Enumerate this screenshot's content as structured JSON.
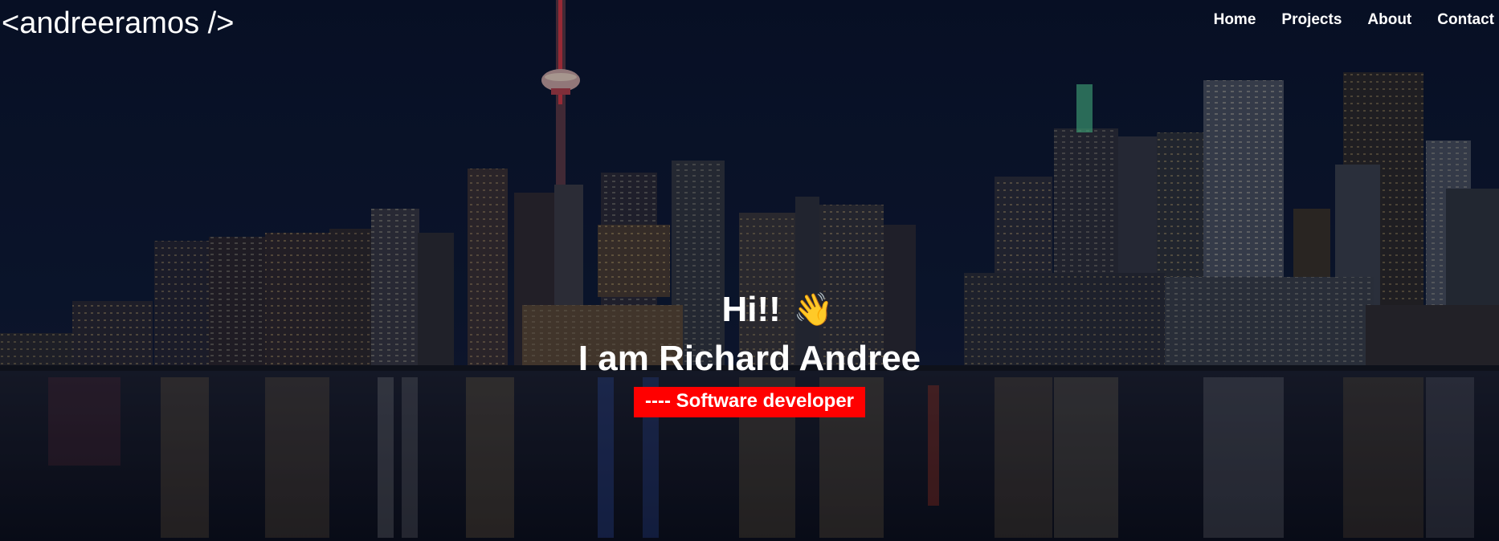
{
  "header": {
    "logo": "<andreeramos />",
    "nav": [
      {
        "label": "Home"
      },
      {
        "label": "Projects"
      },
      {
        "label": "About"
      },
      {
        "label": "Contact"
      }
    ]
  },
  "hero": {
    "greeting": "Hi!!",
    "wave_emoji": "👋",
    "name_line": "I am Richard Andree",
    "role": "---- Software developer",
    "background": "toronto-skyline-night-photo",
    "accent_color": "#ff0000"
  }
}
